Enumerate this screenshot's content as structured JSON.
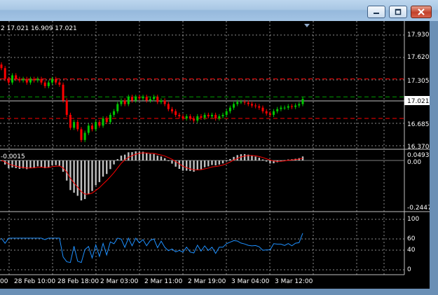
{
  "window": {
    "controls": {
      "minimize_icon": "minimize-icon",
      "maximize_icon": "maximize-icon",
      "close_icon": "close-icon"
    },
    "colors": {
      "titlebar": "#a9c7e4",
      "close": "#c2412a"
    }
  },
  "chart": {
    "ohlc_header": "2 17.021 16.909 17.021",
    "current_price": "17.021",
    "price_ticks": [
      "17.930",
      "17.620",
      "17.305",
      "16.685",
      "16.370"
    ],
    "macd": {
      "label": "-0.0015",
      "ticks": [
        "0.0493",
        "0.00",
        "-0.2447"
      ]
    },
    "rsi": {
      "ticks": [
        "100",
        "60",
        "40",
        "0"
      ]
    },
    "time_labels": [
      "00",
      "28 Feb 10:00",
      "28 Feb 18:00",
      "2 Mar 03:00",
      "2 Mar 11:00",
      "2 Mar 19:00",
      "3 Mar 04:00",
      "3 Mar 12:00"
    ],
    "colors": {
      "background": "#000000",
      "grid": "#ffffff",
      "bull": "#00c800",
      "bear": "#ff0000",
      "level": "#ff0000",
      "macd_hist": "#c0c0c0",
      "macd_signal": "#ff0000",
      "rsi": "#1e90ff",
      "price_line": "#c0c0c0"
    }
  },
  "chart_data": {
    "type": "candlestick",
    "price": {
      "axis_ticks": [
        17.93,
        17.62,
        17.305,
        16.685,
        16.37
      ],
      "close": [
        17.45,
        17.3,
        17.25,
        17.35,
        17.3,
        17.28,
        17.3,
        17.25,
        17.3,
        17.28,
        17.3,
        17.25,
        17.2,
        17.25,
        17.3,
        17.25,
        17.22,
        17.0,
        16.8,
        16.62,
        16.7,
        16.6,
        16.45,
        16.55,
        16.65,
        16.6,
        16.7,
        16.65,
        16.75,
        16.7,
        16.8,
        16.85,
        16.95,
        17.0,
        16.95,
        17.05,
        17.0,
        17.05,
        17.03,
        17.05,
        17.0,
        17.02,
        17.05,
        16.98,
        17.0,
        16.95,
        16.88,
        16.85,
        16.8,
        16.78,
        16.75,
        16.78,
        16.75,
        16.72,
        16.78,
        16.76,
        16.8,
        16.78,
        16.8,
        16.75,
        16.78,
        16.8,
        16.85,
        16.9,
        16.95,
        16.98,
        16.98,
        16.97,
        16.95,
        16.93,
        16.92,
        16.9,
        16.85,
        16.82,
        16.8,
        16.85,
        16.88,
        16.9,
        16.9,
        16.92,
        16.91,
        16.93,
        16.95,
        17.021
      ],
      "levels": [
        17.3,
        17.05,
        16.75
      ],
      "last": 17.021
    },
    "macd": {
      "label": -0.0015,
      "range": [
        -0.2447,
        0.0493
      ],
      "axis_ticks": [
        0.0493,
        0.0,
        -0.2447
      ]
    },
    "rsi": {
      "range": [
        0,
        100
      ],
      "axis_ticks": [
        100,
        60,
        40,
        0
      ],
      "last": 75
    },
    "x_labels": [
      "00",
      "28 Feb 10:00",
      "28 Feb 18:00",
      "2 Mar 03:00",
      "2 Mar 11:00",
      "2 Mar 19:00",
      "3 Mar 04:00",
      "3 Mar 12:00"
    ]
  }
}
